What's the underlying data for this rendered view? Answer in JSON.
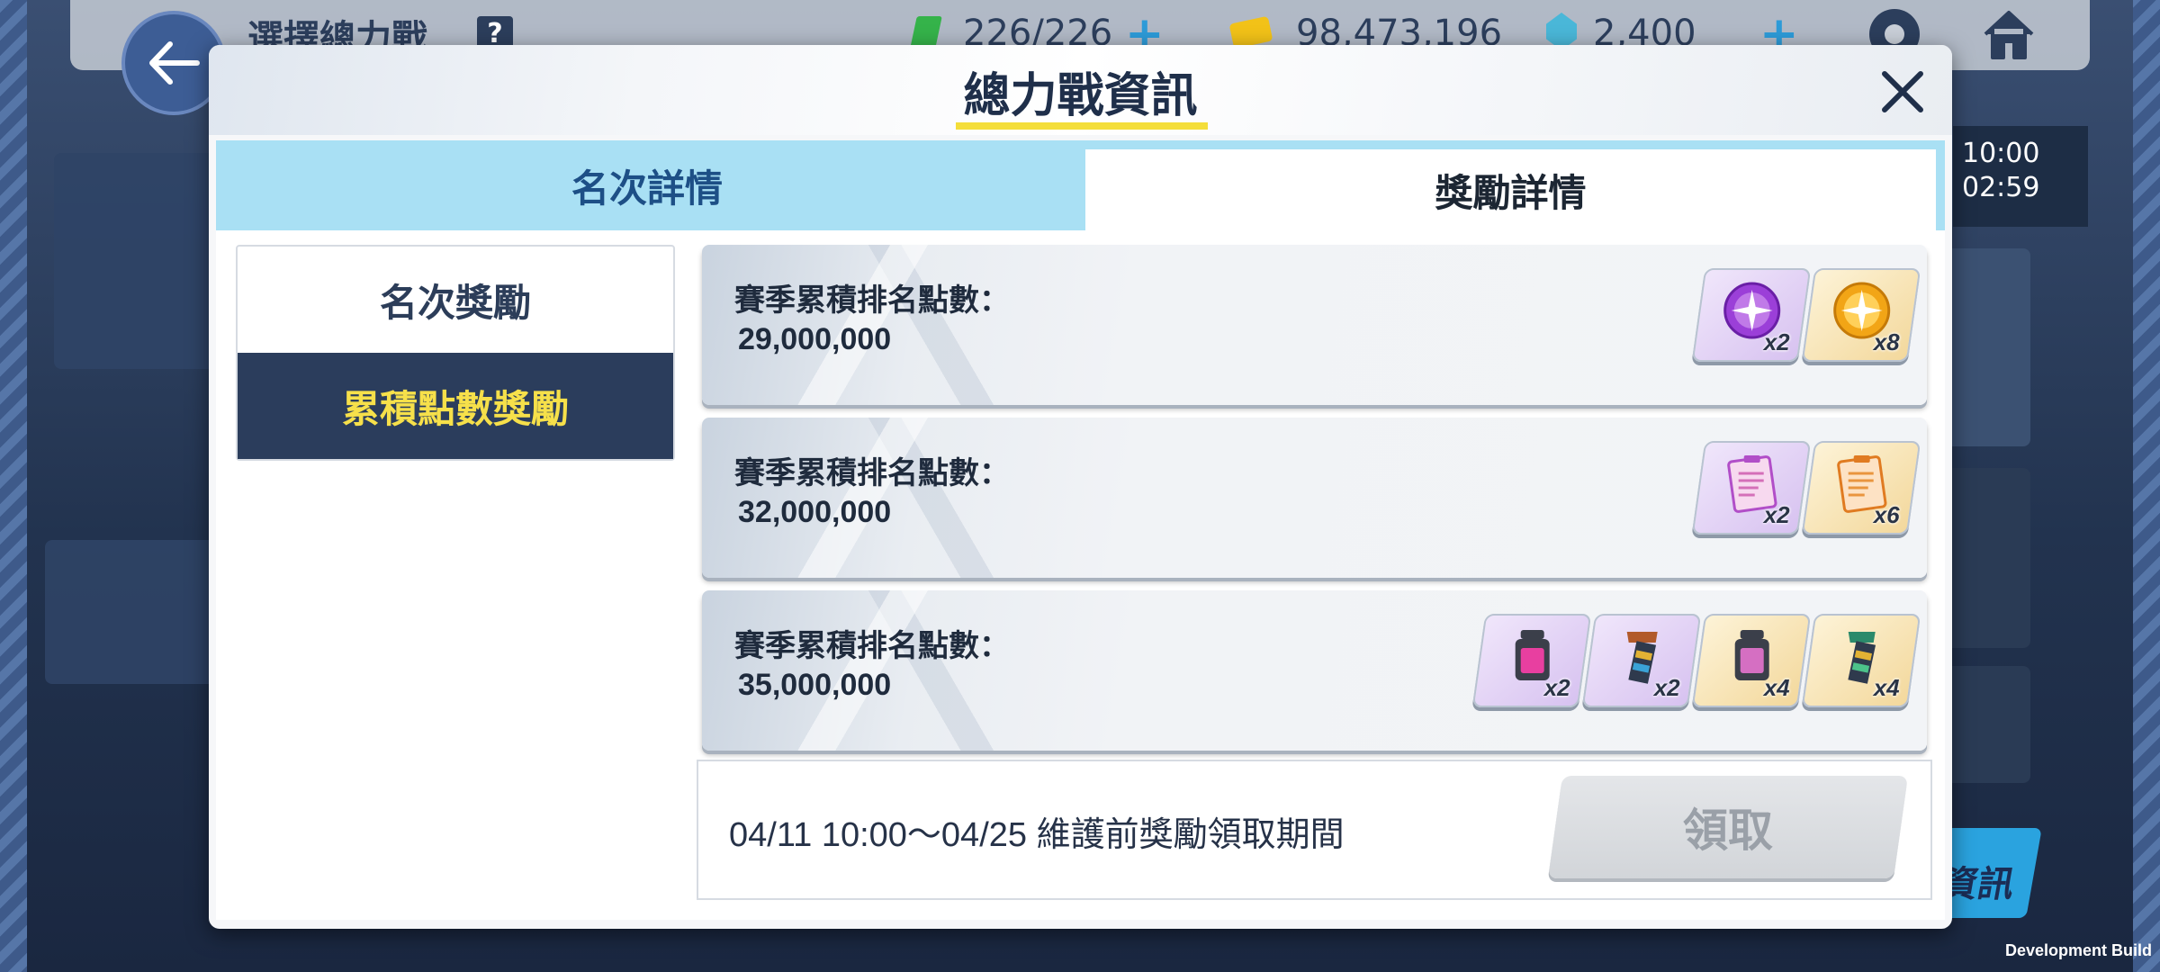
{
  "background": {
    "screen_title": "選擇總力戰",
    "help_label": "?",
    "ap": "226/226",
    "credits": "98,473,196",
    "pyroxene": "2,400",
    "side_time_1": "10:00",
    "side_time_2": "02:59",
    "side_button_label": "資訊",
    "dev_build": "Development Build"
  },
  "modal": {
    "title": "總力戰資訊",
    "tabs": [
      {
        "label": "名次詳情",
        "selected": false
      },
      {
        "label": "獎勵詳情",
        "selected": true
      }
    ],
    "side_menu": [
      {
        "label": "名次獎勵",
        "selected": false
      },
      {
        "label": "累積點數獎勵",
        "selected": true
      }
    ],
    "rows": [
      {
        "label": "賽季累積排名點數：",
        "points": "29,000,000",
        "items": [
          {
            "icon": "purple-eleph-orb-icon",
            "count": "x2"
          },
          {
            "icon": "gold-eleph-orb-icon",
            "count": "x8"
          }
        ]
      },
      {
        "label": "賽季累積排名點數：",
        "points": "32,000,000",
        "items": [
          {
            "icon": "purple-report-icon",
            "count": "x2"
          },
          {
            "icon": "orange-report-icon",
            "count": "x6"
          }
        ]
      },
      {
        "label": "賽季累積排名點數：",
        "points": "35,000,000",
        "items": [
          {
            "icon": "purple-lantern-icon",
            "count": "x2"
          },
          {
            "icon": "purple-totem-icon",
            "count": "x2"
          },
          {
            "icon": "gold-lantern-icon",
            "count": "x4"
          },
          {
            "icon": "gold-totem-icon",
            "count": "x4"
          }
        ]
      }
    ],
    "footer": {
      "period_text": "04/11 10:00～04/25 維護前獎勵領取期間",
      "claim_label": "領取"
    }
  },
  "colors": {
    "accent_yellow": "#f4de3a",
    "tab_blue": "#a9e0f4",
    "menu_active_bg": "#2b3d5c",
    "menu_active_text": "#f6e04a"
  }
}
